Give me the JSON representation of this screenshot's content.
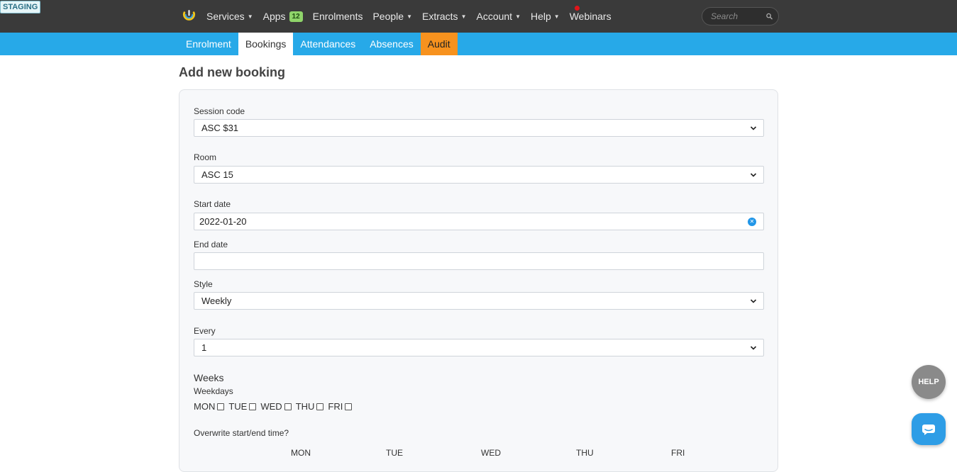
{
  "staging_label": "STAGING",
  "nav": {
    "items": [
      {
        "label": "Services",
        "dropdown": true
      },
      {
        "label": "Apps",
        "badge": "12",
        "dropdown": false
      },
      {
        "label": "Enrolments",
        "dropdown": false
      },
      {
        "label": "People",
        "dropdown": true
      },
      {
        "label": "Extracts",
        "dropdown": true
      },
      {
        "label": "Account",
        "dropdown": true
      },
      {
        "label": "Help",
        "dropdown": true
      },
      {
        "label": "Webinars",
        "dropdown": false
      }
    ],
    "search_placeholder": "Search"
  },
  "tabs": [
    "Enrolment",
    "Bookings",
    "Attendances",
    "Absences",
    "Audit"
  ],
  "page": {
    "title": "Add new booking"
  },
  "form": {
    "session_code": {
      "label": "Session code",
      "value": "ASC $31"
    },
    "room": {
      "label": "Room",
      "value": "ASC 15"
    },
    "start_date": {
      "label": "Start date",
      "value": "2022-01-20"
    },
    "end_date": {
      "label": "End date",
      "value": ""
    },
    "style": {
      "label": "Style",
      "value": "Weekly"
    },
    "every": {
      "label": "Every",
      "value": "1"
    },
    "weeks_heading": "Weeks",
    "weekdays_label": "Weekdays",
    "weekdays": [
      "MON",
      "TUE",
      "WED",
      "THU",
      "FRI"
    ],
    "overwrite_label": "Overwrite start/end time?",
    "time_columns": [
      "MON",
      "TUE",
      "WED",
      "THU",
      "FRI"
    ]
  },
  "help_button": "HELP",
  "colors": {
    "topbar": "#3a3a3a",
    "subnav": "#27a9e8",
    "audit_tab": "#f7921e",
    "apps_badge": "#8fd46a",
    "notification_dot": "#e1151a"
  }
}
